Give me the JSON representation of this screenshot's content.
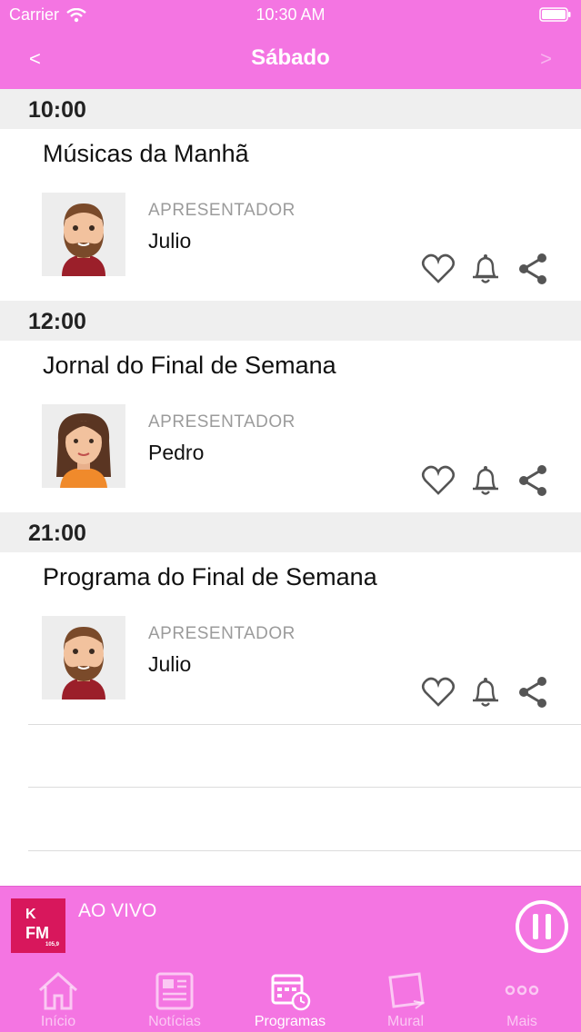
{
  "status_bar": {
    "carrier": "Carrier",
    "time": "10:30 AM"
  },
  "nav": {
    "title": "Sábado",
    "prev_label": "<",
    "next_label": ">"
  },
  "schedule": [
    {
      "time": "10:00",
      "program": "Músicas da Manhã",
      "role": "APRESENTADOR",
      "host": "Julio",
      "avatar": "male-avatar"
    },
    {
      "time": "12:00",
      "program": "Jornal do Final de Semana",
      "role": "APRESENTADOR",
      "host": "Pedro",
      "avatar": "female-avatar"
    },
    {
      "time": "21:00",
      "program": "Programa do Final de Semana",
      "role": "APRESENTADOR",
      "host": "Julio",
      "avatar": "male-avatar"
    }
  ],
  "player": {
    "live_label": "AO VIVO",
    "logo_text": "K FM",
    "logo_freq": "105,9"
  },
  "tabs": [
    {
      "label": "Início",
      "icon": "home-icon",
      "active": false
    },
    {
      "label": "Notícias",
      "icon": "newspaper-icon",
      "active": false
    },
    {
      "label": "Programas",
      "icon": "calendar-icon",
      "active": true
    },
    {
      "label": "Mural",
      "icon": "notes-icon",
      "active": false
    },
    {
      "label": "Mais",
      "icon": "more-icon",
      "active": false
    }
  ],
  "colors": {
    "primary": "#f475e2",
    "logo": "#d8175c",
    "section_bg": "#efefef",
    "muted_text": "#9b9b9b"
  }
}
